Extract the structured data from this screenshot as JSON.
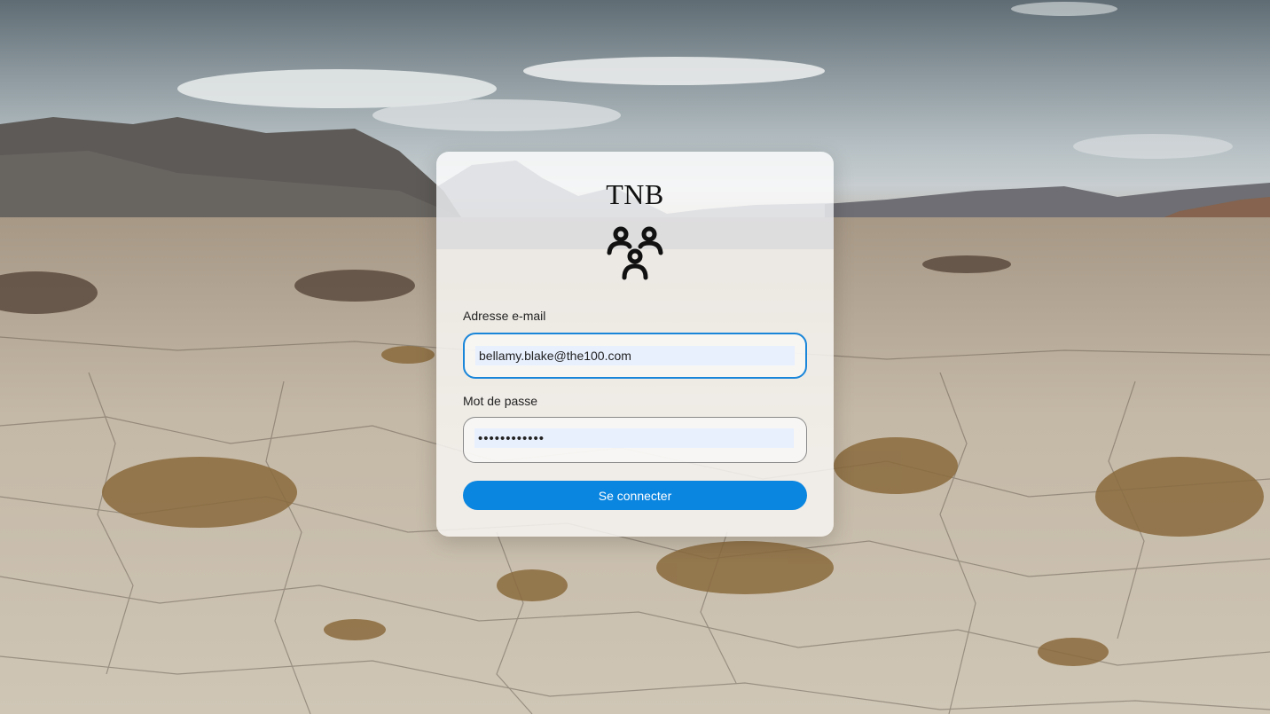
{
  "app": {
    "brand": "TNB",
    "logo_icon": "users-group-icon"
  },
  "form": {
    "email_label": "Adresse e-mail",
    "email_value": "bellamy.blake@the100.com",
    "password_label": "Mot de passe",
    "password_value": "••••••••••••",
    "submit_label": "Se connecter"
  },
  "colors": {
    "accent": "#0a85e0",
    "focus_border": "#1a86d9",
    "autofill_bg": "#e8f0fe"
  }
}
